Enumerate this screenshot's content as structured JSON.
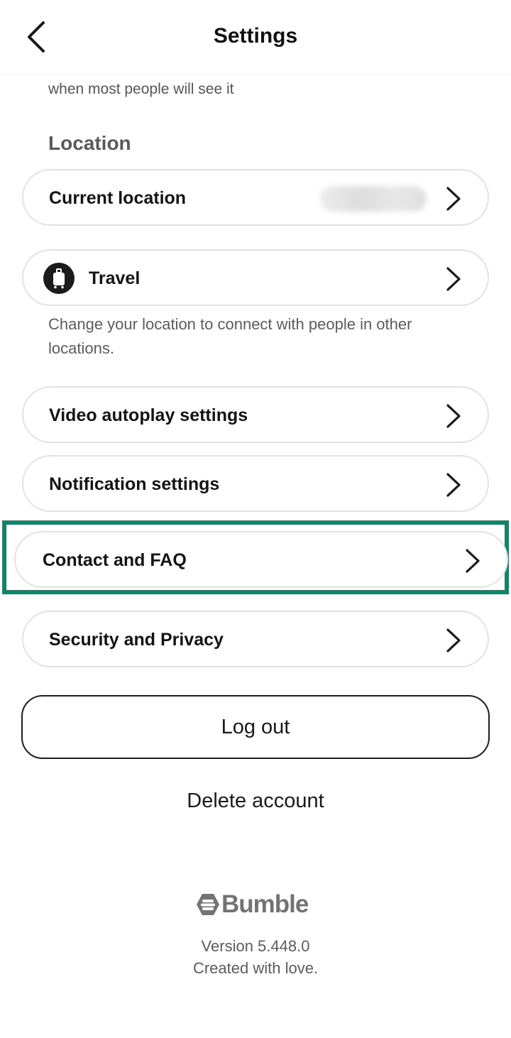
{
  "header": {
    "title": "Settings"
  },
  "scrolled_text": "when most people will see it",
  "location": {
    "heading": "Location",
    "current_location_label": "Current location",
    "travel_label": "Travel",
    "travel_helper": "Change your location to connect with people in other locations."
  },
  "menu": {
    "video_autoplay": "Video autoplay settings",
    "notifications": "Notification settings",
    "contact_faq": "Contact and FAQ",
    "security_privacy": "Security and Privacy"
  },
  "actions": {
    "logout": "Log out",
    "delete_account": "Delete account"
  },
  "footer": {
    "brand": "Bumble",
    "version": "Version 5.448.0",
    "tagline": "Created with love."
  },
  "colors": {
    "highlight": "#138468",
    "row_border": "#e2e2e2",
    "text_primary": "#141414",
    "text_secondary": "#5c5c5c"
  },
  "icons": {
    "back": "chevron-left-icon",
    "row_arrow": "chevron-right-icon",
    "travel": "suitcase-icon",
    "brand": "bumble-logo-icon"
  }
}
